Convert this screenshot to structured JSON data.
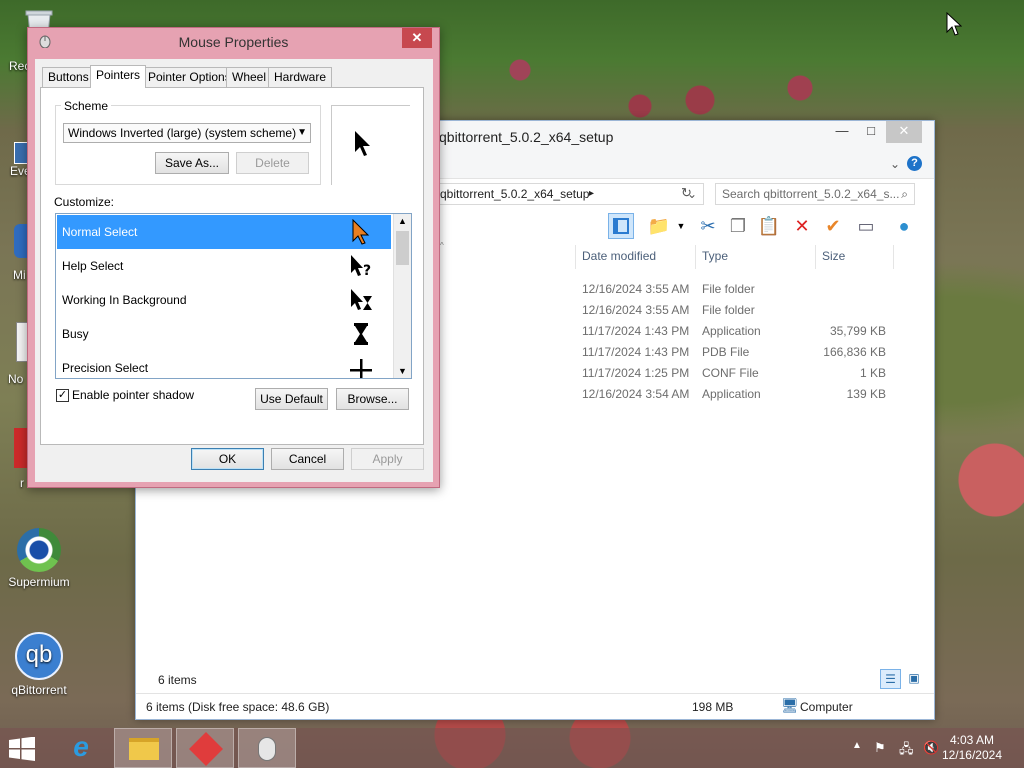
{
  "desktop": {
    "icons": [
      {
        "label": "Supermium"
      },
      {
        "label": "qBittorrent"
      }
    ],
    "partial_labels": [
      "Rec",
      "Eve",
      "Mi",
      "No",
      "r"
    ]
  },
  "explorer": {
    "title": "qbittorrent_5.0.2_x64_setup",
    "address": "qbittorrent_5.0.2_x64_setup",
    "search_placeholder": "Search qbittorrent_5.0.2_x64_s...",
    "columns": {
      "date": "Date modified",
      "type": "Type",
      "size": "Size"
    },
    "rows": [
      {
        "date": "12/16/2024 3:55 AM",
        "type": "File folder",
        "size": ""
      },
      {
        "date": "12/16/2024 3:55 AM",
        "type": "File folder",
        "size": ""
      },
      {
        "date": "11/17/2024 1:43 PM",
        "type": "Application",
        "size": "35,799 KB"
      },
      {
        "date": "11/17/2024 1:43 PM",
        "type": "PDB File",
        "size": "166,836 KB"
      },
      {
        "date": "11/17/2024 1:25 PM",
        "type": "CONF File",
        "size": "1 KB"
      },
      {
        "date": "12/16/2024 3:54 AM",
        "type": "Application",
        "size": "139 KB"
      }
    ],
    "item_count": "6 items",
    "status": {
      "left": "6 items (Disk free space: 48.6 GB)",
      "middle": "198 MB",
      "right": "Computer"
    }
  },
  "dialog": {
    "title": "Mouse Properties",
    "tabs": [
      "Buttons",
      "Pointers",
      "Pointer Options",
      "Wheel",
      "Hardware"
    ],
    "active_tab": "Pointers",
    "scheme_label": "Scheme",
    "scheme_value": "Windows Inverted (large) (system scheme)",
    "save_as": "Save As...",
    "delete": "Delete",
    "customize_label": "Customize:",
    "list": [
      {
        "label": "Normal Select",
        "icon": "arrow-cursor-icon",
        "selected": true
      },
      {
        "label": "Help Select",
        "icon": "help-cursor-icon",
        "selected": false
      },
      {
        "label": "Working In Background",
        "icon": "working-cursor-icon",
        "selected": false
      },
      {
        "label": "Busy",
        "icon": "hourglass-cursor-icon",
        "selected": false
      },
      {
        "label": "Precision Select",
        "icon": "crosshair-cursor-icon",
        "selected": false
      }
    ],
    "shadow_label": "Enable pointer shadow",
    "shadow_checked": true,
    "use_default": "Use Default",
    "browse": "Browse...",
    "ok": "OK",
    "cancel": "Cancel",
    "apply": "Apply"
  },
  "taskbar": {
    "time": "4:03 AM",
    "date": "12/16/2024"
  },
  "colors": {
    "dialog_frame": "#e6a2b2",
    "selection": "#3399ff",
    "close_button": "#c7484f"
  }
}
